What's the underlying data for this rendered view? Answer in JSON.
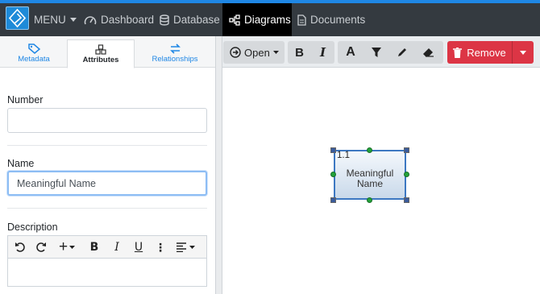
{
  "nav": {
    "menu_label": "MENU",
    "items": [
      {
        "label": "Dashboard",
        "icon": "gauge-icon"
      },
      {
        "label": "Database",
        "icon": "database-icon"
      },
      {
        "label": "Diagrams",
        "icon": "diagram-icon",
        "active": true
      },
      {
        "label": "Documents",
        "icon": "document-icon"
      }
    ]
  },
  "left_panel": {
    "tabs": [
      {
        "label": "Metadata",
        "icon": "tag-icon"
      },
      {
        "label": "Attributes",
        "icon": "cubes-icon",
        "active": true
      },
      {
        "label": "Relationships",
        "icon": "exchange-icon"
      }
    ],
    "fields": {
      "number_label": "Number",
      "number_value": "",
      "name_label": "Name",
      "name_value": "Meaningful Name",
      "description_label": "Description"
    },
    "editor_toolbar": [
      "undo",
      "redo",
      "insert",
      "bold",
      "italic",
      "underline",
      "more",
      "align"
    ]
  },
  "diagram_toolbar": {
    "open_label": "Open",
    "remove_label": "Remove"
  },
  "diagram": {
    "node": {
      "number": "1.1",
      "name_line1": "Meaningful",
      "name_line2": "Name"
    }
  },
  "colors": {
    "accent": "#1f87e5",
    "nav_bg": "#343a40",
    "danger": "#dc3545",
    "node_border": "#3d78c2"
  }
}
